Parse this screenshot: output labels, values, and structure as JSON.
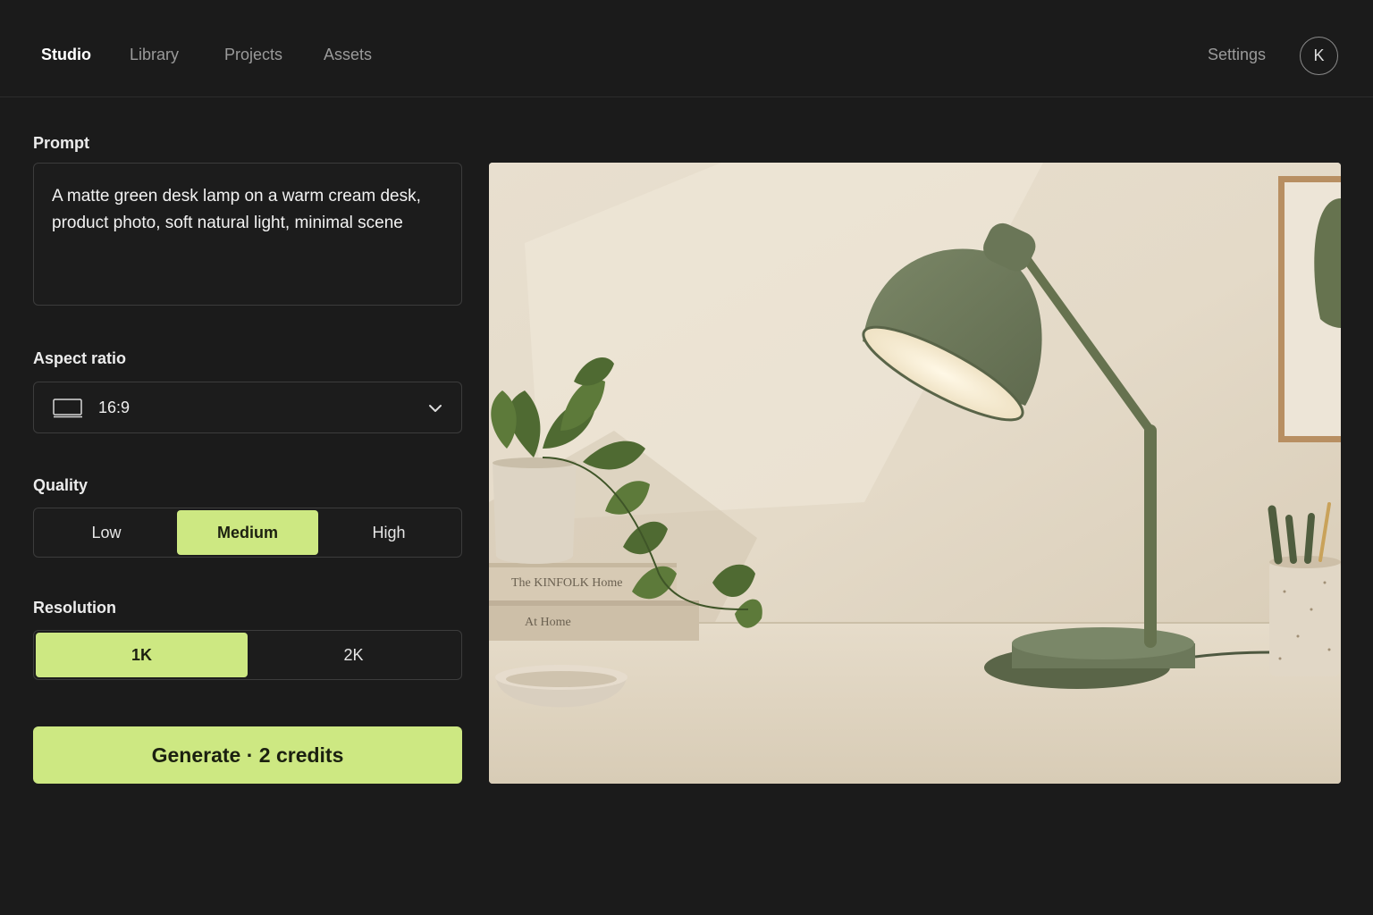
{
  "nav": {
    "tabs": [
      {
        "label": "Studio",
        "active": true
      },
      {
        "label": "Library",
        "active": false
      },
      {
        "label": "Projects",
        "active": false
      },
      {
        "label": "Assets",
        "active": false
      }
    ],
    "settings_label": "Settings",
    "avatar_initial": "K"
  },
  "prompt": {
    "label": "Prompt",
    "value": "A matte green desk lamp on a warm cream desk, product photo, soft natural light, minimal scene"
  },
  "aspect_ratio": {
    "label": "Aspect ratio",
    "value": "16:9",
    "icon": "landscape-frame-icon"
  },
  "quality": {
    "label": "Quality",
    "options": [
      "Low",
      "Medium",
      "High"
    ],
    "selected": "Medium"
  },
  "resolution": {
    "label": "Resolution",
    "options": [
      "1K",
      "2K"
    ],
    "selected": "1K"
  },
  "generate": {
    "label": "Generate · 2 credits"
  },
  "preview": {
    "book_titles": [
      "The KINFOLK Home",
      "At Home"
    ]
  },
  "colors": {
    "accent": "#cde882",
    "background": "#1b1b1b",
    "border": "#3c3c3c",
    "lamp_green": "#6f7b5d"
  }
}
